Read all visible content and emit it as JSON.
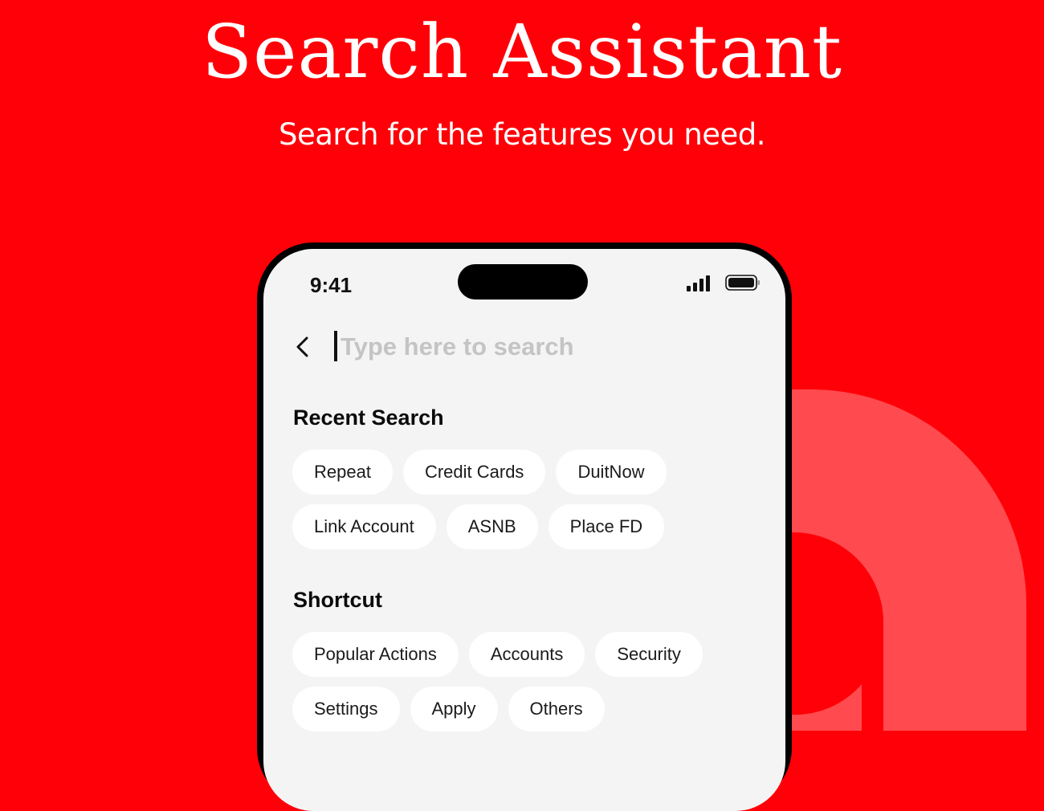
{
  "page": {
    "title": "Search Assistant",
    "subtitle": "Search for the features you need.",
    "colors": {
      "background": "#ff0008",
      "decor": "#ff4a4f",
      "screen": "#f4f4f4",
      "chip": "#ffffff",
      "placeholder": "#c4c4c4"
    }
  },
  "status_bar": {
    "time": "9:41",
    "signal_icon": "cellular-signal-icon",
    "battery_icon": "battery-icon"
  },
  "search": {
    "back_icon": "chevron-left-icon",
    "value": "",
    "placeholder": "Type here to search"
  },
  "recent_search": {
    "title": "Recent Search",
    "items": [
      "Repeat",
      "Credit Cards",
      "DuitNow",
      "Link Account",
      "ASNB",
      "Place FD"
    ]
  },
  "shortcut": {
    "title": "Shortcut",
    "items": [
      "Popular Actions",
      "Accounts",
      "Security",
      "Settings",
      "Apply",
      "Others"
    ]
  }
}
